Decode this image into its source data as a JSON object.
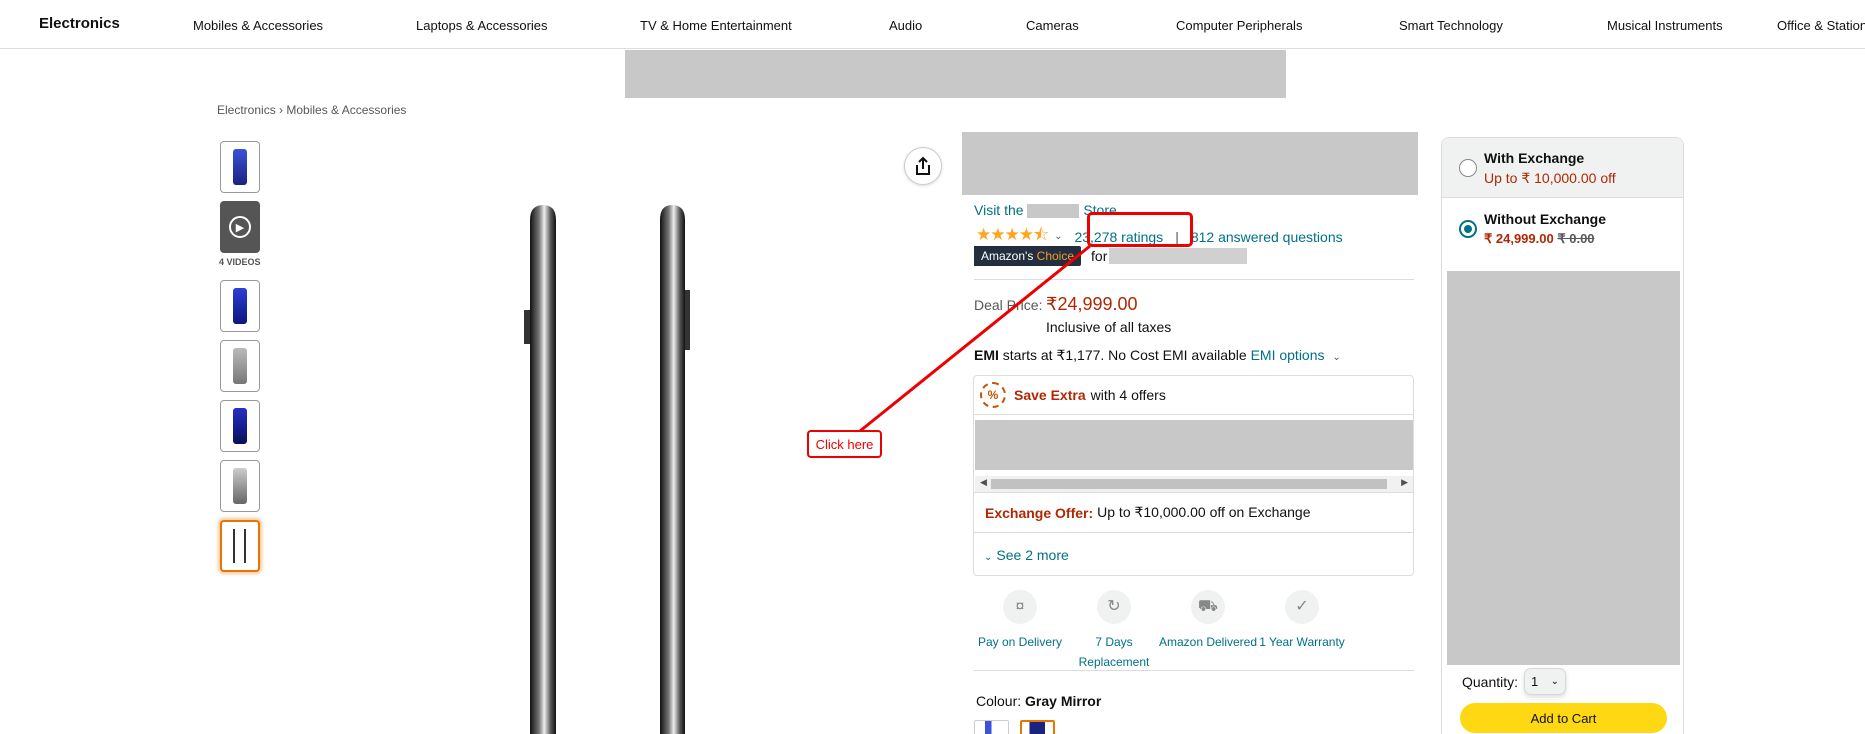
{
  "nav": {
    "brand": "Electronics",
    "items": [
      "Mobiles & Accessories",
      "Laptops & Accessories",
      "TV & Home Entertainment",
      "Audio",
      "Cameras",
      "Computer Peripherals",
      "Smart Technology",
      "Musical Instruments",
      "Office & Station"
    ]
  },
  "breadcrumb": {
    "root": "Electronics",
    "separator": "›",
    "current": "Mobiles & Accessories"
  },
  "gallery": {
    "videos_label": "4 VIDEOS"
  },
  "product": {
    "visit_prefix": "Visit the",
    "visit_suffix": "Store",
    "ratings_count": "23,278 ratings",
    "separator": "|",
    "answered": "812 answered questions",
    "choice_part1": "Amazon's",
    "choice_part2": "Choice",
    "choice_for": "for",
    "deal_label": "Deal Price:",
    "deal_price": "₹24,999.00",
    "inclusive": "Inclusive of all taxes",
    "emi_bold": "EMI",
    "emi_text": "starts at ₹1,177. No Cost EMI available",
    "emi_link": "EMI options"
  },
  "offers": {
    "save_extra": "Save Extra",
    "with_offers": "with 4 offers",
    "exchange_label": "Exchange Offer:",
    "exchange_text": "Up to ₹10,000.00 off on Exchange",
    "see_more": "See 2 more"
  },
  "features": [
    {
      "label": "Pay on Delivery",
      "icon": "cash-icon"
    },
    {
      "label": "7 Days Replacement",
      "icon": "replacement-icon"
    },
    {
      "label": "Amazon Delivered",
      "icon": "delivery-truck-icon"
    },
    {
      "label": "1 Year Warranty",
      "icon": "shield-icon"
    }
  ],
  "colour": {
    "label": "Colour:",
    "value": "Gray Mirror"
  },
  "buybox": {
    "with_exchange_title": "With Exchange",
    "with_exchange_sub": "Up to ₹ 10,000.00 off",
    "without_exchange_title": "Without Exchange",
    "without_price": "₹ 24,999.00",
    "without_strike": "₹ 0.00",
    "quantity_label": "Quantity:",
    "quantity_value": "1",
    "add_to_cart": "Add to Cart"
  },
  "annotation": {
    "label": "Click here"
  },
  "colors": {
    "link": "#007185",
    "price": "#b12704",
    "cart": "#ffd814",
    "annotation": "#ee0000"
  }
}
